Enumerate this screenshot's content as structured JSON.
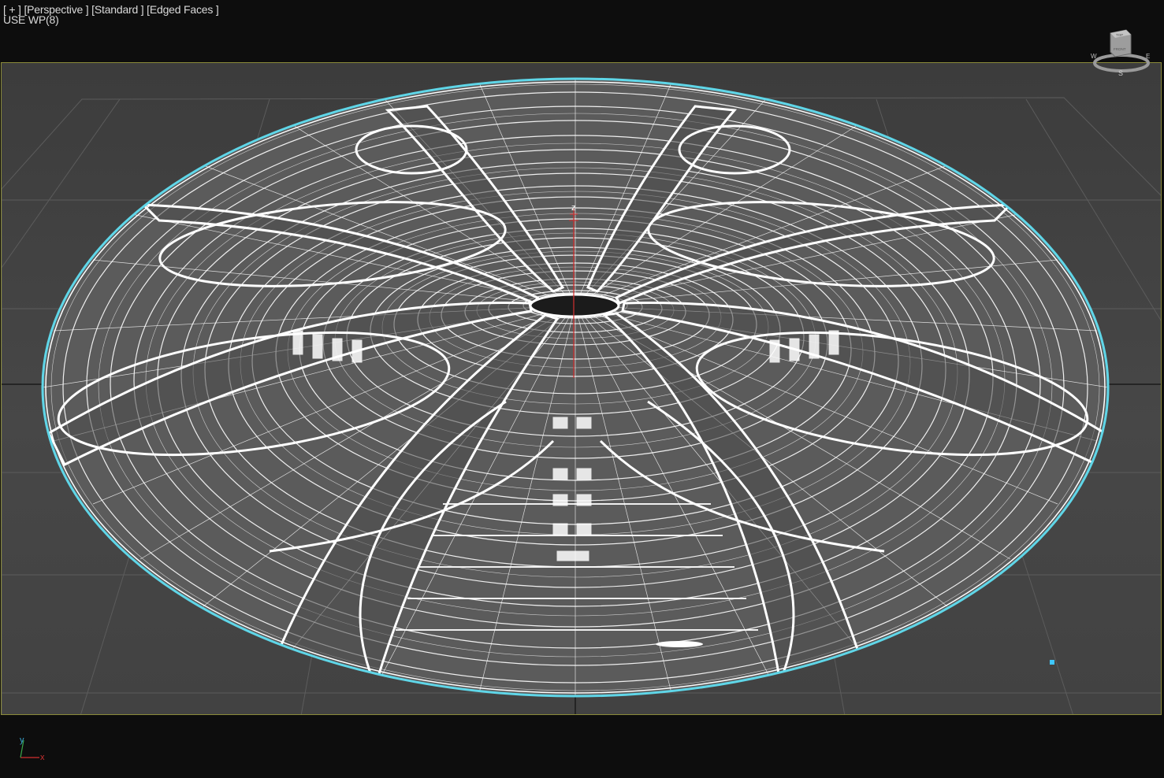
{
  "viewport": {
    "menu_label": "[ + ]",
    "view_label": "[Perspective ]",
    "shading_standard": "[Standard ]",
    "shading_edges": "[Edged Faces ]",
    "workplane_label": "USE WP(8)"
  },
  "viewcube": {
    "top_face": "TOP",
    "front_face": "FRONT",
    "compass_w": "W",
    "compass_e": "E",
    "compass_s": "S"
  },
  "axis_tripod": {
    "x_label": "x",
    "y_label": "y"
  },
  "gizmo": {
    "z_label": "z"
  },
  "colors": {
    "viewport_bg": "#434343",
    "grid": "#5a5a5a",
    "wire": "#ffffff",
    "selection": "#5fd6e8",
    "frame": "#8a8a3a"
  }
}
